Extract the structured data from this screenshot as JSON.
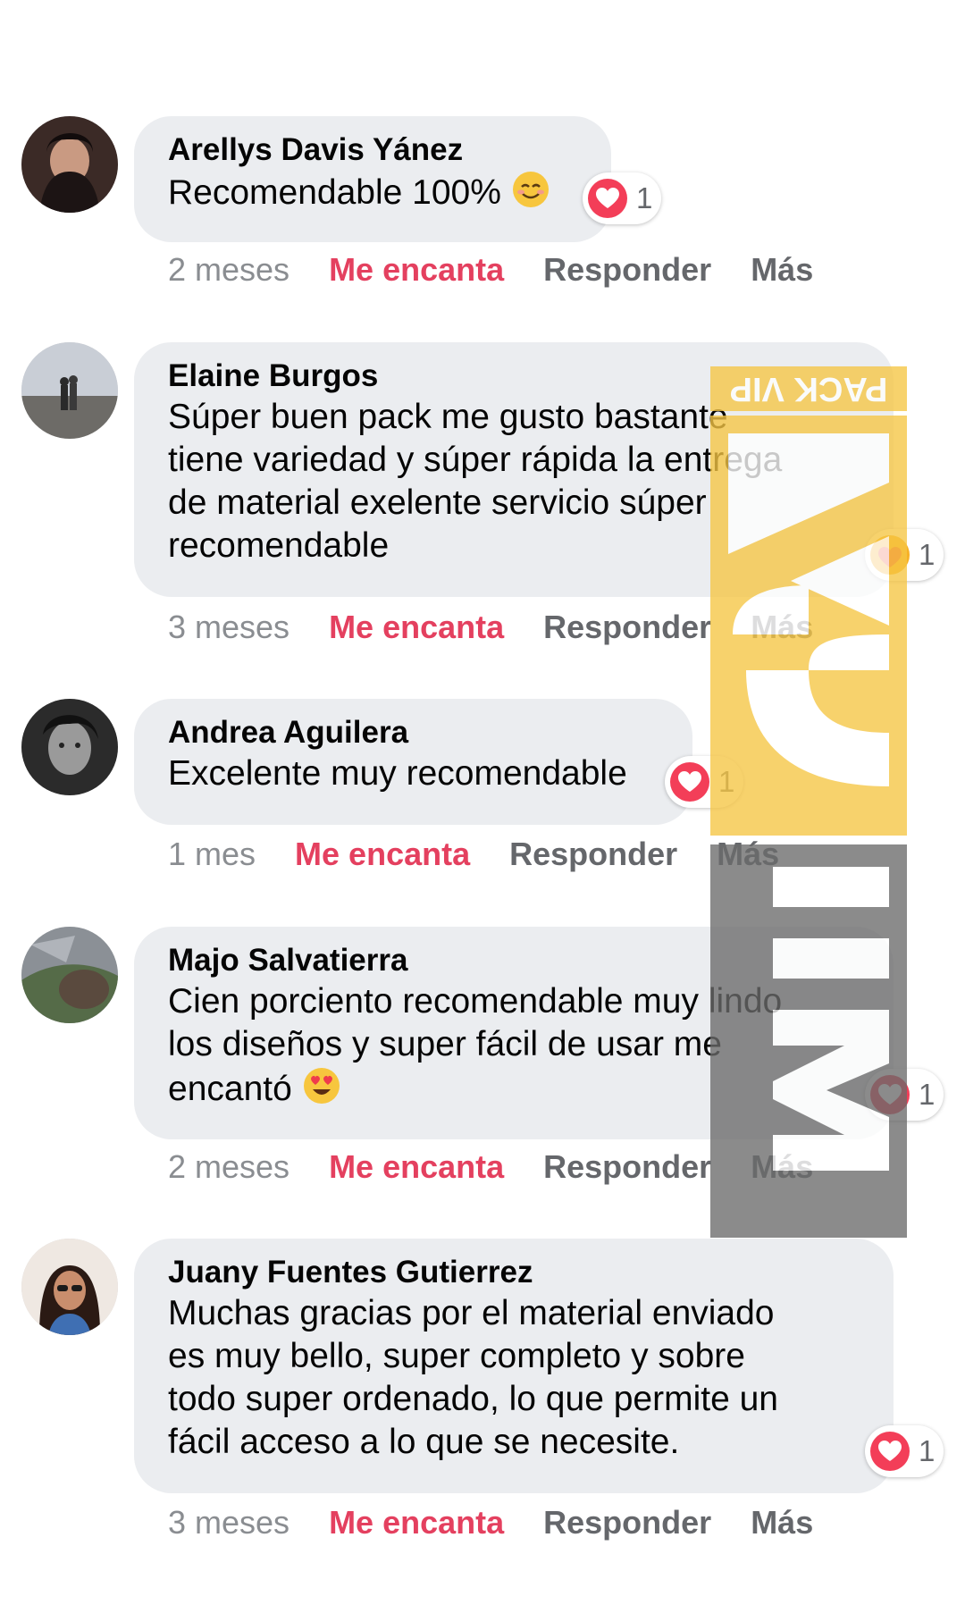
{
  "comments": [
    {
      "author": "Arellys Davis Yánez",
      "text": "Recomendable 100%",
      "emoji": "smiling-face-icon",
      "reaction": {
        "icon": "heart-reaction-icon",
        "count": "1"
      },
      "time": "2 meses",
      "love_label": "Me encanta",
      "reply_label": "Responder",
      "more_label": "Más"
    },
    {
      "author": "Elaine Burgos",
      "lines": [
        "Súper buen pack me gusto bastante",
        "tiene variedad y súper rápida la entrega",
        "de material exelente servicio súper",
        "recomendable"
      ],
      "reaction": {
        "icon": "care-reaction-icon",
        "count": "1"
      },
      "time": "3 meses",
      "love_label": "Me encanta",
      "reply_label": "Responder",
      "more_label": "Más"
    },
    {
      "author": "Andrea Aguilera",
      "text": "Excelente muy recomendable",
      "reaction": {
        "icon": "heart-reaction-icon",
        "count": "1"
      },
      "time": "1 mes",
      "love_label": "Me encanta",
      "reply_label": "Responder",
      "more_label": "Más"
    },
    {
      "author": "Majo Salvatierra",
      "lines": [
        "Cien porciento recomendable muy lindo",
        "los diseños y super fácil de usar me",
        "encantó"
      ],
      "emoji": "heart-eyes-icon",
      "reaction": {
        "icon": "heart-reaction-icon",
        "count": "1"
      },
      "time": "2 meses",
      "love_label": "Me encanta",
      "reply_label": "Responder",
      "more_label": "Más"
    },
    {
      "author": "Juany Fuentes Gutierrez",
      "lines": [
        "Muchas gracias por el material enviado",
        "es muy bello, super completo y sobre",
        "todo super ordenado, lo que permite un",
        "fácil acceso a lo que se necesite."
      ],
      "reaction": {
        "icon": "heart-reaction-icon",
        "count": "1"
      },
      "time": "3 meses",
      "love_label": "Me encanta",
      "reply_label": "Responder",
      "more_label": "Más"
    }
  ],
  "watermark": {
    "label": "PACK VIP",
    "brand": "MECA"
  },
  "colors": {
    "bubble": "#ebedf0",
    "love": "#e4405f",
    "muted": "#65676b",
    "heart": "#f33e58",
    "care": "#f7b125",
    "watermark_yellow": "#f6c644",
    "watermark_gray": "#6b6b6b"
  }
}
